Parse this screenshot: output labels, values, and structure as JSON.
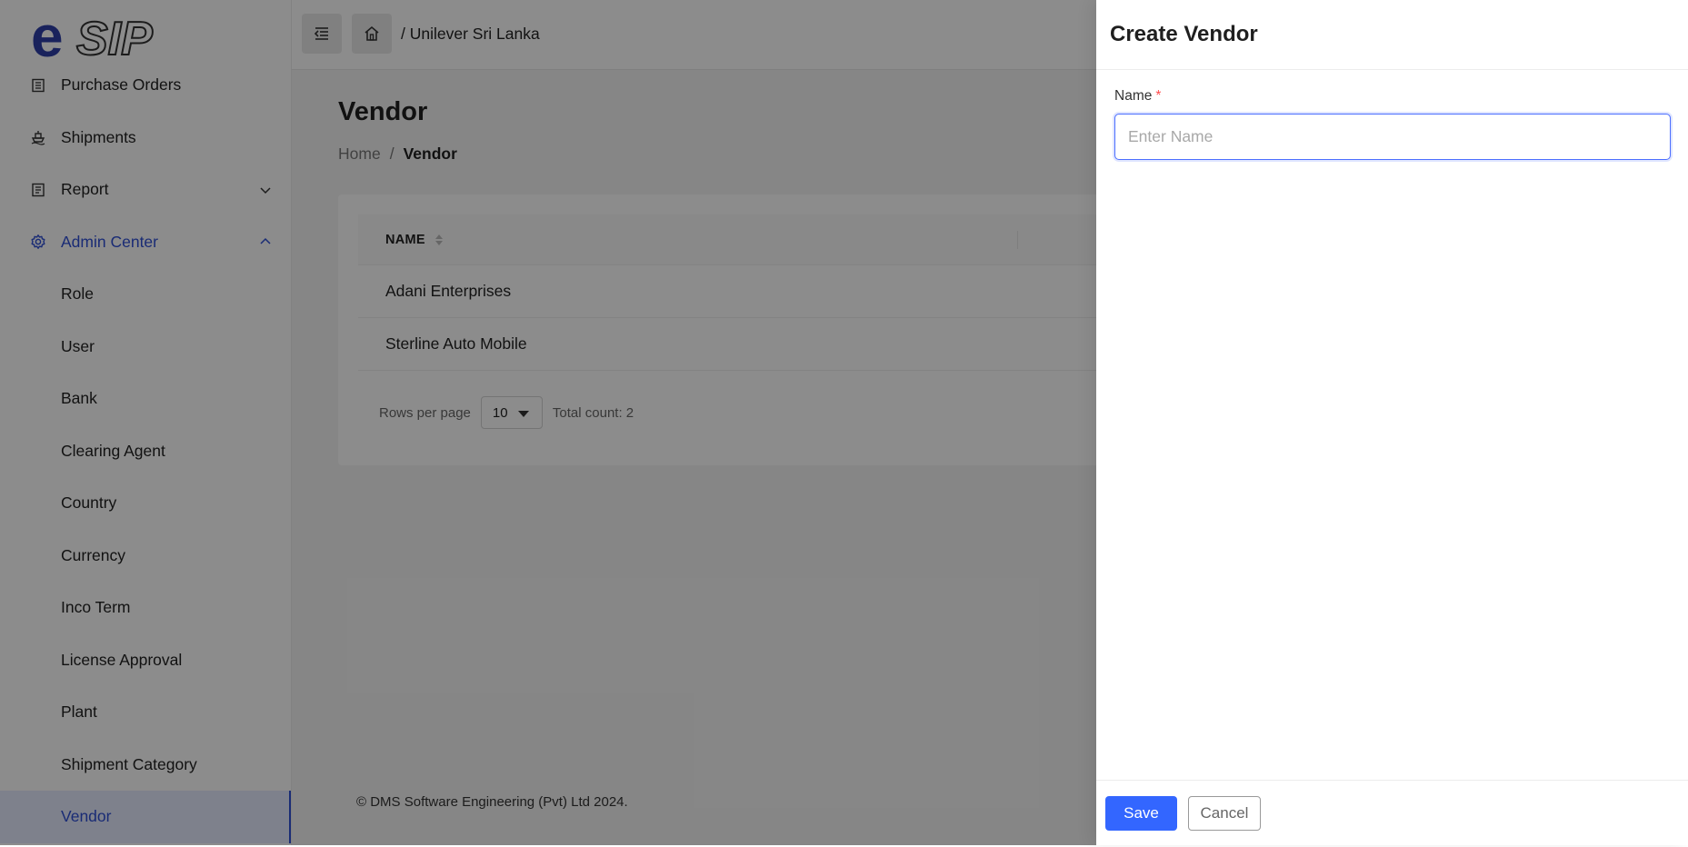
{
  "app": {
    "logo_text": "eSIP"
  },
  "sidebar": {
    "items": [
      {
        "label": "Purchase Orders",
        "icon": "document-icon"
      },
      {
        "label": "Shipments",
        "icon": "ship-icon"
      },
      {
        "label": "Report",
        "icon": "report-icon",
        "expandable": true,
        "expanded": false
      },
      {
        "label": "Admin Center",
        "icon": "gear-icon",
        "expandable": true,
        "expanded": true
      }
    ],
    "sub_items": [
      {
        "label": "Role"
      },
      {
        "label": "User"
      },
      {
        "label": "Bank"
      },
      {
        "label": "Clearing Agent"
      },
      {
        "label": "Country"
      },
      {
        "label": "Currency"
      },
      {
        "label": "Inco Term"
      },
      {
        "label": "License Approval"
      },
      {
        "label": "Plant"
      },
      {
        "label": "Shipment Category"
      },
      {
        "label": "Vendor",
        "selected": true
      }
    ]
  },
  "topbar": {
    "breadcrumb": "/ Unilever Sri Lanka"
  },
  "page": {
    "title": "Vendor",
    "breadcrumb": {
      "home": "Home",
      "sep": "/",
      "current": "Vendor"
    }
  },
  "table": {
    "column_name": "NAME",
    "rows": [
      {
        "name": "Adani Enterprises"
      },
      {
        "name": "Sterline Auto Mobile"
      }
    ],
    "pagination": {
      "rows_per_page_label": "Rows per page",
      "rows_per_page_value": "10",
      "total_count": "Total count: 2"
    }
  },
  "footer": {
    "text": "© DMS Software Engineering (Pvt) Ltd 2024."
  },
  "drawer": {
    "title": "Create Vendor",
    "name_label": "Name",
    "required_mark": "*",
    "name_value": "",
    "name_placeholder": "Enter Name",
    "save_label": "Save",
    "cancel_label": "Cancel"
  },
  "colors": {
    "accent": "#3366ff",
    "brand": "#2f3fa8",
    "required": "#ff4d4f"
  }
}
